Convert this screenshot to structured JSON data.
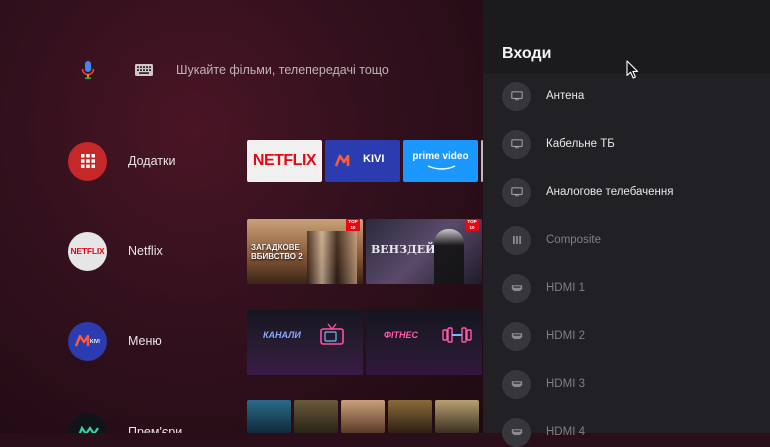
{
  "search": {
    "placeholder": "Шукайте фільми, телепередачі тощо"
  },
  "rows": [
    {
      "label": "Додатки"
    },
    {
      "label": "Netflix"
    },
    {
      "label": "Меню"
    },
    {
      "label": "Прем'єри"
    }
  ],
  "apps": {
    "netflix": "NETFLIX",
    "kivi": "KIVI",
    "prime": "prime video"
  },
  "netflix_tiles": {
    "glass_onion": "ЗАГАДКОВЕ ВБИВСТВО 2",
    "wednesday": "ВЕНЗДЕЙ",
    "badge": "TOP 10"
  },
  "menu_tiles": {
    "channels": "КАНАЛИ",
    "fitness": "ФІТНЕС"
  },
  "panel": {
    "title": "Входи",
    "inputs": [
      {
        "label": "Антена",
        "icon": "tv-icon",
        "state": "active"
      },
      {
        "label": "Кабельне ТБ",
        "icon": "tv-icon",
        "state": "active"
      },
      {
        "label": "Аналогове телебачення",
        "icon": "tv-icon",
        "state": "active"
      },
      {
        "label": "Composite",
        "icon": "composite-icon",
        "state": "inactive"
      },
      {
        "label": "HDMI 1",
        "icon": "hdmi-icon",
        "state": "inactive"
      },
      {
        "label": "HDMI 2",
        "icon": "hdmi-icon",
        "state": "inactive"
      },
      {
        "label": "HDMI 3",
        "icon": "hdmi-icon",
        "state": "inactive"
      },
      {
        "label": "HDMI 4",
        "icon": "hdmi-icon",
        "state": "inactive"
      }
    ]
  },
  "colors": {
    "netflix_red": "#e50914",
    "apps_red": "#c62828",
    "prime_blue": "#1a98ff",
    "kivi_blue": "#2b3bb0",
    "panel_bg": "#212125"
  }
}
